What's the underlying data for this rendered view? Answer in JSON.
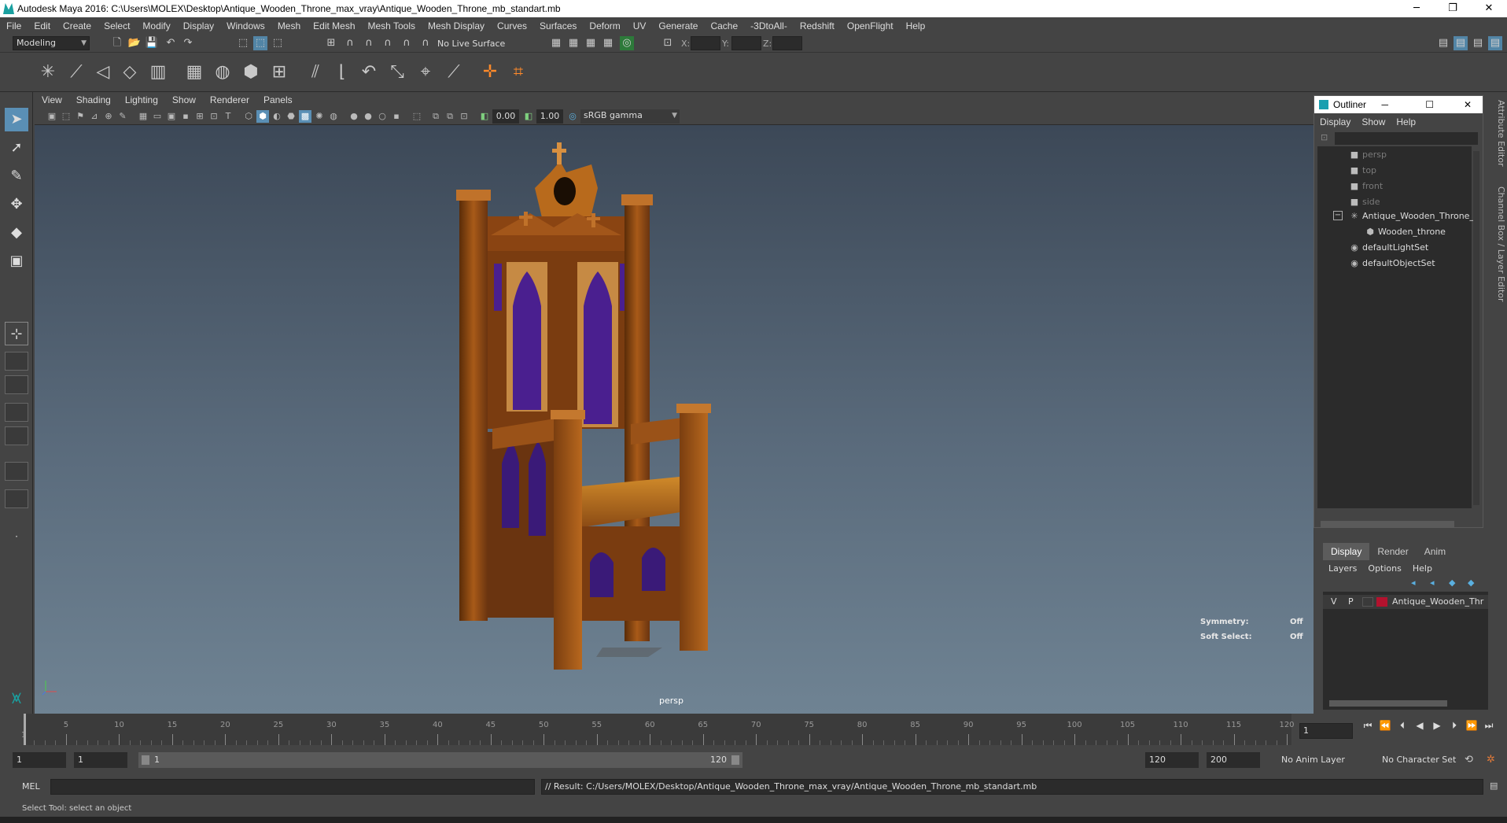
{
  "window": {
    "title": "Autodesk Maya 2016: C:\\Users\\MOLEX\\Desktop\\Antique_Wooden_Throne_max_vray\\Antique_Wooden_Throne_mb_standart.mb",
    "minimize": "─",
    "restore": "❐",
    "close": "✕"
  },
  "menubar": [
    "File",
    "Edit",
    "Create",
    "Select",
    "Modify",
    "Display",
    "Windows",
    "Mesh",
    "Edit Mesh",
    "Mesh Tools",
    "Mesh Display",
    "Curves",
    "Surfaces",
    "Deform",
    "UV",
    "Generate",
    "Cache",
    "-3DtoAll-",
    "Redshift",
    "OpenFlight",
    "Help"
  ],
  "statusline": {
    "mode": "Modeling",
    "live_surface": "No Live Surface",
    "x_label": "X:",
    "y_label": "Y:",
    "z_label": "Z:"
  },
  "viewport": {
    "menu": [
      "View",
      "Shading",
      "Lighting",
      "Show",
      "Renderer",
      "Panels"
    ],
    "exposure": "0.00",
    "gamma": "1.00",
    "colorspace": "sRGB gamma",
    "camera": "persp",
    "symmetry_label": "Symmetry:",
    "symmetry_value": "Off",
    "softselect_label": "Soft Select:",
    "softselect_value": "Off"
  },
  "outliner": {
    "title": "Outliner",
    "menu": [
      "Display",
      "Show",
      "Help"
    ],
    "items": [
      {
        "label": "persp",
        "icon": "camera-icon"
      },
      {
        "label": "top",
        "icon": "camera-icon"
      },
      {
        "label": "front",
        "icon": "camera-icon"
      },
      {
        "label": "side",
        "icon": "camera-icon"
      },
      {
        "label": "Antique_Wooden_Throne_",
        "icon": "group-icon"
      },
      {
        "label": "Wooden_throne",
        "icon": "mesh-icon"
      },
      {
        "label": "defaultLightSet",
        "icon": "set-icon"
      },
      {
        "label": "defaultObjectSet",
        "icon": "set-icon"
      }
    ],
    "collapse": "−"
  },
  "layers": {
    "tabs": [
      "Display",
      "Render",
      "Anim"
    ],
    "menu": [
      "Layers",
      "Options",
      "Help"
    ],
    "row": {
      "v": "V",
      "p": "P",
      "name": "Antique_Wooden_Thr",
      "color": "#b3122e"
    }
  },
  "sidetabs": {
    "attribute_editor": "Attribute Editor",
    "channel_box": "Channel Box / Layer Editor"
  },
  "timeline": {
    "ticks": [
      5,
      10,
      15,
      20,
      25,
      30,
      35,
      40,
      45,
      50,
      55,
      60,
      65,
      70,
      75,
      80,
      85,
      90,
      95,
      100,
      105,
      110,
      115,
      120
    ],
    "start_label": "1",
    "current_frame": "1"
  },
  "range": {
    "start": "1",
    "playback_start": "1",
    "range_start": "1",
    "range_end": "120",
    "playback_end": "120",
    "end": "200",
    "anim_layer": "No Anim Layer",
    "character_set": "No Character Set"
  },
  "command": {
    "language": "MEL",
    "result": "// Result: C:/Users/MOLEX/Desktop/Antique_Wooden_Throne_max_vray/Antique_Wooden_Throne_mb_standart.mb"
  },
  "helpline": "Select Tool: select an object",
  "colors": {
    "accent": "#5a8fb5",
    "wood": "#8a4a12",
    "fabric": "#4a1f8f",
    "maya_teal": "#1aa0a0"
  }
}
